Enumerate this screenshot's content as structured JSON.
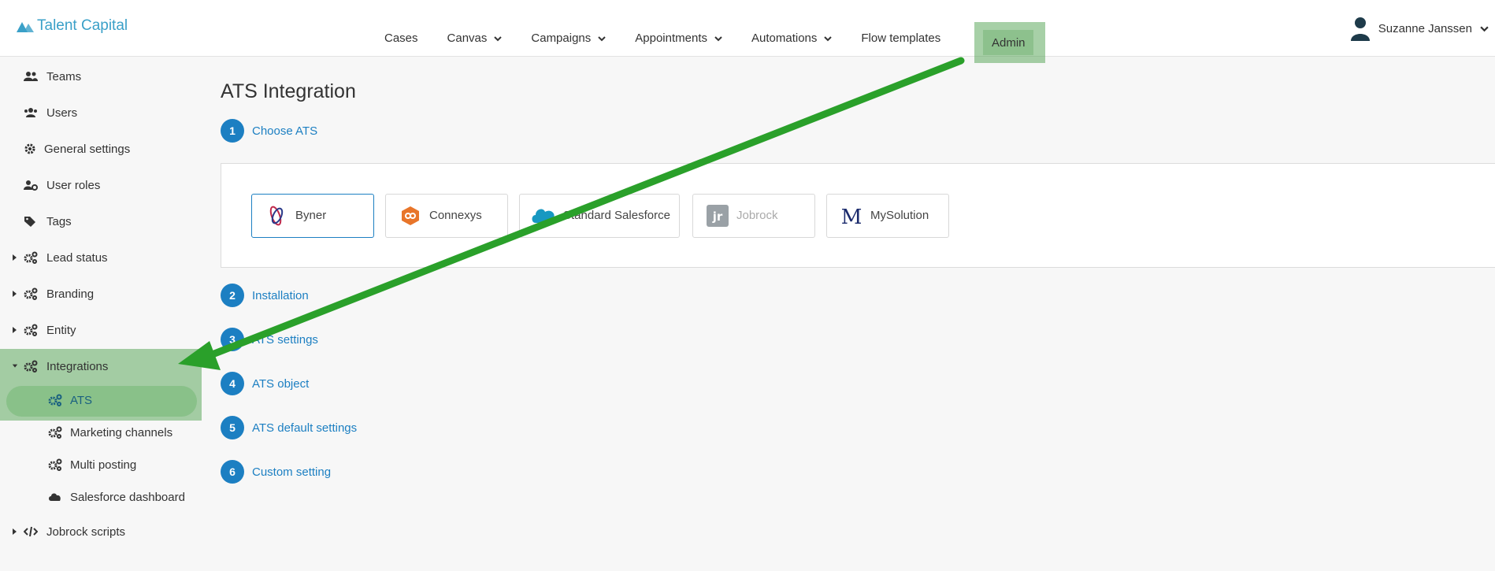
{
  "header": {
    "brand": "Talent Capital",
    "nav": [
      {
        "label": "Cases",
        "dropdown": false
      },
      {
        "label": "Canvas",
        "dropdown": true
      },
      {
        "label": "Campaigns",
        "dropdown": true
      },
      {
        "label": "Appointments",
        "dropdown": true
      },
      {
        "label": "Automations",
        "dropdown": true
      },
      {
        "label": "Flow templates",
        "dropdown": false
      }
    ],
    "admin_label": "Admin",
    "user_name": "Suzanne Janssen"
  },
  "sidebar": {
    "items": [
      {
        "label": "Teams",
        "icon": "users-icon"
      },
      {
        "label": "Users",
        "icon": "user-group-icon"
      },
      {
        "label": "General settings",
        "icon": "gear-icon"
      },
      {
        "label": "User roles",
        "icon": "user-cog-icon"
      },
      {
        "label": "Tags",
        "icon": "tags-icon"
      },
      {
        "label": "Lead status",
        "icon": "cogs-icon",
        "expandable": true
      },
      {
        "label": "Branding",
        "icon": "cogs-icon",
        "expandable": true
      },
      {
        "label": "Entity",
        "icon": "cogs-icon",
        "expandable": true
      },
      {
        "label": "Integrations",
        "icon": "cogs-icon",
        "expandable": true,
        "expanded": true
      },
      {
        "label": "ATS",
        "icon": "cogs-icon",
        "sub": true,
        "active": true
      },
      {
        "label": "Marketing channels",
        "icon": "cogs-icon",
        "sub": true
      },
      {
        "label": "Multi posting",
        "icon": "cogs-icon",
        "sub": true
      },
      {
        "label": "Salesforce dashboard",
        "icon": "cloud-icon",
        "sub": true
      },
      {
        "label": "Jobrock scripts",
        "icon": "code-icon",
        "expandable": true
      }
    ]
  },
  "main": {
    "title": "ATS Integration",
    "steps": [
      {
        "num": "1",
        "label": "Choose ATS"
      },
      {
        "num": "2",
        "label": "Installation"
      },
      {
        "num": "3",
        "label": "ATS settings"
      },
      {
        "num": "4",
        "label": "ATS object"
      },
      {
        "num": "5",
        "label": "ATS default settings"
      },
      {
        "num": "6",
        "label": "Custom setting"
      }
    ],
    "ats_options": [
      {
        "name": "Byner",
        "selected": true
      },
      {
        "name": "Connexys"
      },
      {
        "name": "Standard Salesforce"
      },
      {
        "name": "Jobrock",
        "disabled": true
      },
      {
        "name": "MySolution"
      }
    ]
  },
  "colors": {
    "accent": "#1c7fc2",
    "brand": "#3aa0c8",
    "highlight": "#3c963c",
    "arrow": "#2aa02a"
  }
}
